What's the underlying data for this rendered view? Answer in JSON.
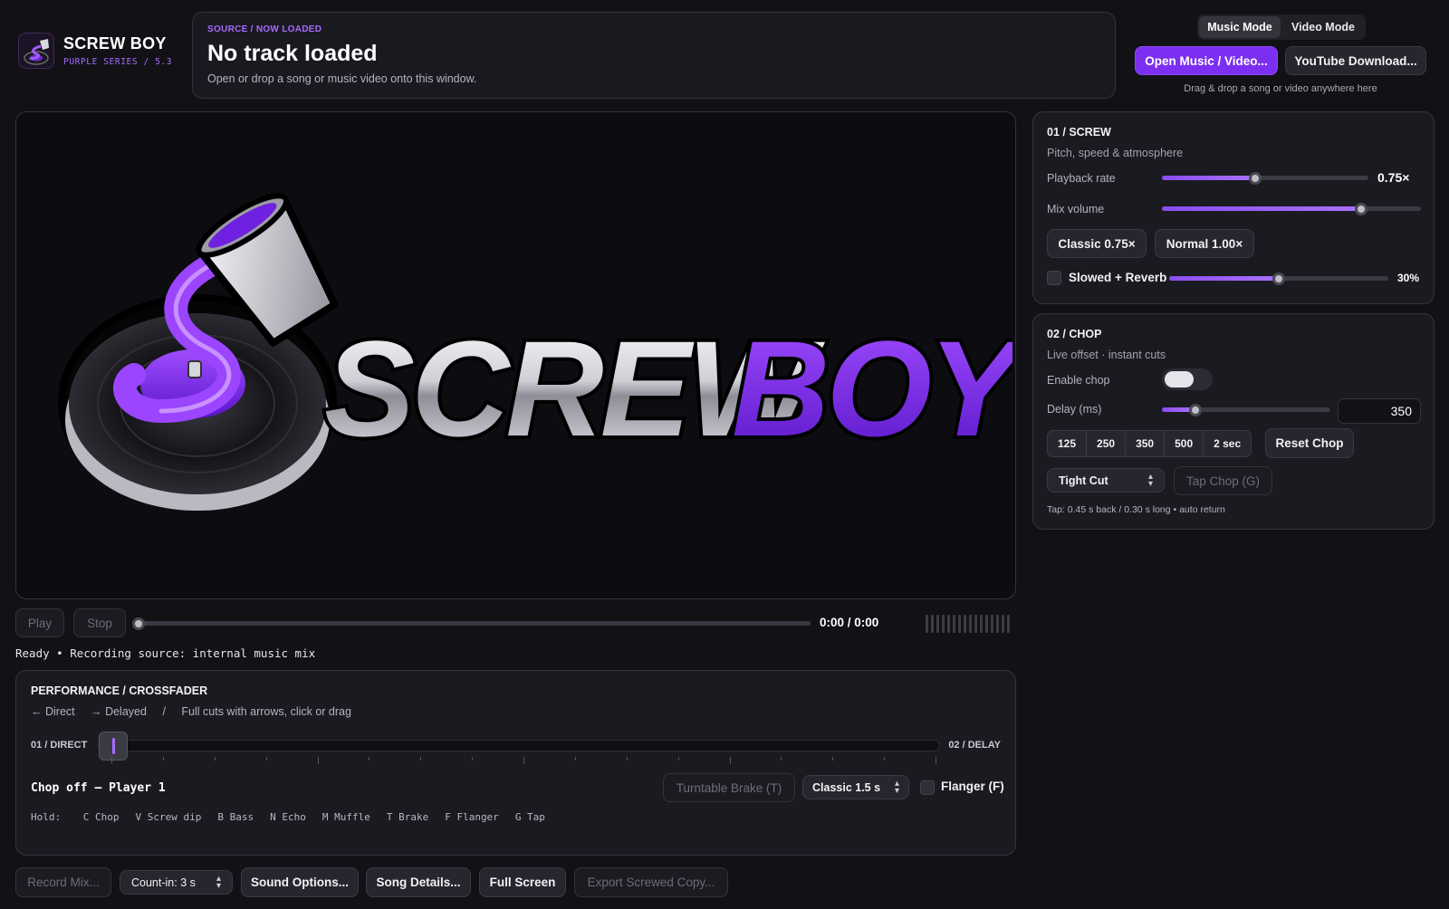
{
  "app": {
    "name": "SCREW BOY",
    "series": "PURPLE SERIES / 5.3"
  },
  "source": {
    "eyebrow": "SOURCE / NOW LOADED",
    "title": "No track loaded",
    "hint": "Open or drop a song or music video onto this window."
  },
  "modes": {
    "music": "Music Mode",
    "video": "Video Mode",
    "active": "Music Mode"
  },
  "top_actions": {
    "open": "Open Music / Video...",
    "youtube": "YouTube Download...",
    "drag_hint": "Drag & drop a song or video anywhere here"
  },
  "transport": {
    "play": "Play",
    "stop": "Stop",
    "time": "0:00 / 0:00",
    "progress_fraction": 0,
    "status": "Ready • Recording source: internal music mix"
  },
  "performance": {
    "heading": "PERFORMANCE / CROSSFADER",
    "hint_direct": "← Direct",
    "hint_delayed": "→ Delayed",
    "hint_sep": "/",
    "hint_text": "Full cuts with arrows, click or drag",
    "left_label": "01 / DIRECT",
    "right_label": "02 / DELAY",
    "crossfader_position": 0,
    "player_status": "Chop off — Player 1",
    "turntable_brake": "Turntable Brake (T)",
    "brake_select": "Classic 1.5 s",
    "flanger_label": "Flanger (F)",
    "hotkeys_prefix": "Hold:",
    "hotkeys": [
      {
        "key": "C",
        "name": "Chop"
      },
      {
        "key": "V",
        "name": "Screw dip"
      },
      {
        "key": "B",
        "name": "Bass"
      },
      {
        "key": "N",
        "name": "Echo"
      },
      {
        "key": "M",
        "name": "Muffle"
      },
      {
        "key": "T",
        "name": "Brake"
      },
      {
        "key": "F",
        "name": "Flanger"
      },
      {
        "key": "G",
        "name": "Tap"
      }
    ]
  },
  "bottom_bar": {
    "record": "Record Mix...",
    "countin": "Count-in: 3 s",
    "sound_options": "Sound Options...",
    "song_details": "Song Details...",
    "full_screen": "Full Screen",
    "export": "Export Screwed Copy..."
  },
  "screw": {
    "heading": "01 / SCREW",
    "subtitle": "Pitch, speed & atmosphere",
    "rate_label": "Playback rate",
    "rate_value": "0.75×",
    "rate_fraction": 0.45,
    "volume_label": "Mix volume",
    "volume_fraction": 0.77,
    "preset_classic": "Classic 0.75×",
    "preset_normal": "Normal 1.00×",
    "reverb_label": "Slowed + Reverb",
    "reverb_value": "30%",
    "reverb_fraction": 0.5
  },
  "chop": {
    "heading": "02 / CHOP",
    "subtitle": "Live offset · instant cuts",
    "enable_label": "Enable chop",
    "enabled": false,
    "delay_label": "Delay (ms)",
    "delay_value": "350",
    "delay_fraction": 0.2,
    "presets": [
      "125",
      "250",
      "350",
      "500",
      "2 sec"
    ],
    "reset": "Reset Chop",
    "cut_select": "Tight Cut",
    "tap_chop": "Tap Chop (G)",
    "tap_info": "Tap: 0.45 s back / 0.30 s long • auto return"
  },
  "logo": {
    "word1": "SCREW",
    "word2": "BOY"
  },
  "colors": {
    "accent": "#7c2ff0",
    "accent_light": "#a872ff",
    "background": "#111116",
    "panel": "#1a1a21"
  }
}
